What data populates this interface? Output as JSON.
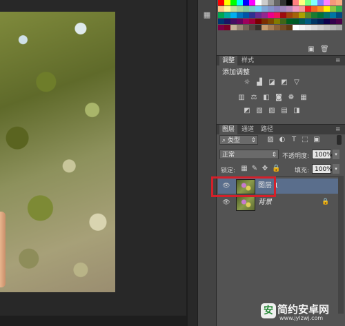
{
  "adjustments_panel": {
    "tabs": [
      "调整",
      "样式"
    ],
    "active_tab": 0,
    "title": "添加调整",
    "icons": [
      [
        "brightness-icon",
        "levels-icon",
        "curves-icon",
        "exposure-icon",
        "vibrance-icon"
      ],
      [
        "hue-saturation-icon",
        "color-balance-icon",
        "black-white-icon",
        "photo-filter-icon",
        "channel-mixer-icon",
        "color-lookup-icon"
      ],
      [
        "invert-icon",
        "posterize-icon",
        "threshold-icon",
        "gradient-map-icon",
        "selective-color-icon"
      ]
    ]
  },
  "layers_panel": {
    "tabs": [
      "图层",
      "通道",
      "路径"
    ],
    "active_tab": 0,
    "filter_label": "类型",
    "blend_mode": "正常",
    "opacity_label": "不透明度:",
    "opacity_value": "100%",
    "lock_label": "锁定:",
    "fill_label": "填充:",
    "fill_value": "100%",
    "layers": [
      {
        "name": "图层 1",
        "selected": true,
        "locked": false
      },
      {
        "name": "背景",
        "selected": false,
        "locked": true
      }
    ]
  },
  "watermark": {
    "logo_letter": "安",
    "text": "简约安卓网",
    "url": "www.jylzwj.com"
  },
  "colors": {
    "panel_bg": "#535353",
    "selected_layer": "#5a6e8c",
    "highlight_border": "#d4202a"
  },
  "swatches": [
    "#ff0000",
    "#ffff00",
    "#00ff00",
    "#00ffff",
    "#0000ff",
    "#ff00ff",
    "#ffffff",
    "#cccccc",
    "#999999",
    "#666666",
    "#333333",
    "#000000",
    "#ff8080",
    "#ffff80",
    "#80ff80",
    "#80ffff",
    "#8080ff",
    "#ff80ff",
    "#f7977a",
    "#f9ad81",
    "#fdc68a",
    "#fff79a",
    "#c4df9b",
    "#a3d39c",
    "#82ca9d",
    "#7bcdc8",
    "#6ecff6",
    "#7ea7d8",
    "#8493ca",
    "#8882be",
    "#a187be",
    "#bc8dbf",
    "#f49ac2",
    "#f6989d",
    "#ed1c24",
    "#f26522",
    "#f7941d",
    "#fff200",
    "#8dc73f",
    "#39b54a",
    "#00a651",
    "#00a99d",
    "#00aeef",
    "#0072bc",
    "#0054a6",
    "#2e3192",
    "#662d91",
    "#92278f",
    "#ec008c",
    "#ed145b",
    "#9e0b0f",
    "#a0410d",
    "#a36209",
    "#aba000",
    "#598527",
    "#1a7b30",
    "#007236",
    "#00746b",
    "#0076a3",
    "#004b80",
    "#003471",
    "#1b1464",
    "#440e62",
    "#630460",
    "#9e005d",
    "#9e0039",
    "#790000",
    "#7b2e00",
    "#7d4900",
    "#827b00",
    "#406618",
    "#005e20",
    "#005826",
    "#005952",
    "#005b7f",
    "#003663",
    "#002157",
    "#0d004c",
    "#32004b",
    "#4b0049",
    "#7b0046",
    "#7a0026",
    "#c7b299",
    "#998675",
    "#736357",
    "#534741",
    "#37302a",
    "#c69c6d",
    "#a67c52",
    "#8c6239",
    "#754c24",
    "#603913",
    "#ffffff",
    "#f2f2f2",
    "#e6e6e6",
    "#d9d9d9",
    "#cccccc",
    "#bfbfbf",
    "#b3b3b3",
    "#a6a6a6"
  ]
}
